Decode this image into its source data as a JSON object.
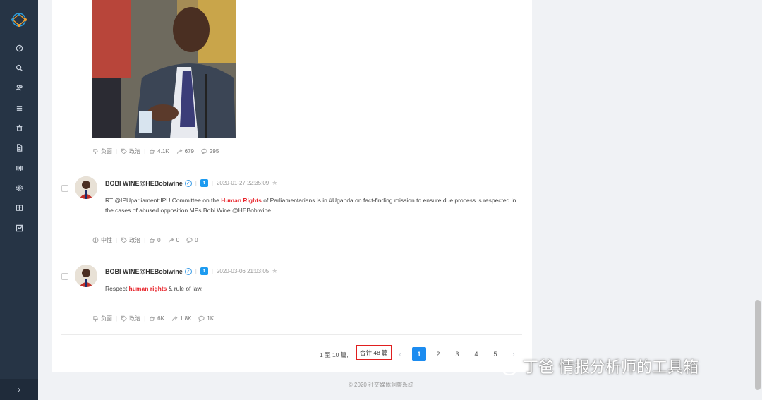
{
  "sidebar": {
    "nav_icons": [
      "dashboard-icon",
      "search-icon",
      "users-icon",
      "list-icon",
      "alarm-icon",
      "document-icon",
      "broadcast-icon",
      "settings-icon",
      "report-icon",
      "chart-icon"
    ],
    "collapse_label": "›"
  },
  "post0": {
    "sentiment": "负面",
    "category": "政治",
    "likes": "4.1K",
    "shares": "679",
    "comments": "295"
  },
  "posts": [
    {
      "author": "BOBI WINE@HEBobiwine",
      "platform": "t",
      "time": "2020-01-27 22:35:09",
      "text_parts": [
        "RT @IPUparliament:IPU Committee on the ",
        "Human Rights",
        " of Parliamentarians is in #Uganda on fact-finding mission to ensure due process is respected in the cases of abused opposition MPs Bobi Wine @HEBobiwine"
      ],
      "sentiment": "中性",
      "category": "政治",
      "likes": "0",
      "shares": "0",
      "comments": "0"
    },
    {
      "author": "BOBI WINE@HEBobiwine",
      "platform": "t",
      "time": "2020-03-06 21:03:05",
      "text_parts": [
        "Respect ",
        "human rights",
        " & rule of law."
      ],
      "sentiment": "负面",
      "category": "政治",
      "likes": "6K",
      "shares": "1.8K",
      "comments": "1K"
    }
  ],
  "pagination": {
    "range": "1 至 10 篇,",
    "total": "合计 48 篇",
    "prev": "‹",
    "pages": [
      "1",
      "2",
      "3",
      "4"
    ],
    "more": "5",
    "next": "›",
    "current": "1"
  },
  "footer": "© 2020 社交媒体洞察系统",
  "watermark": "丁爸 情报分析师的工具箱",
  "colors": {
    "sidebar": "#263445",
    "highlight": "#e8262d",
    "active_page": "#1c8cf0",
    "total_border": "#e01f1f"
  }
}
